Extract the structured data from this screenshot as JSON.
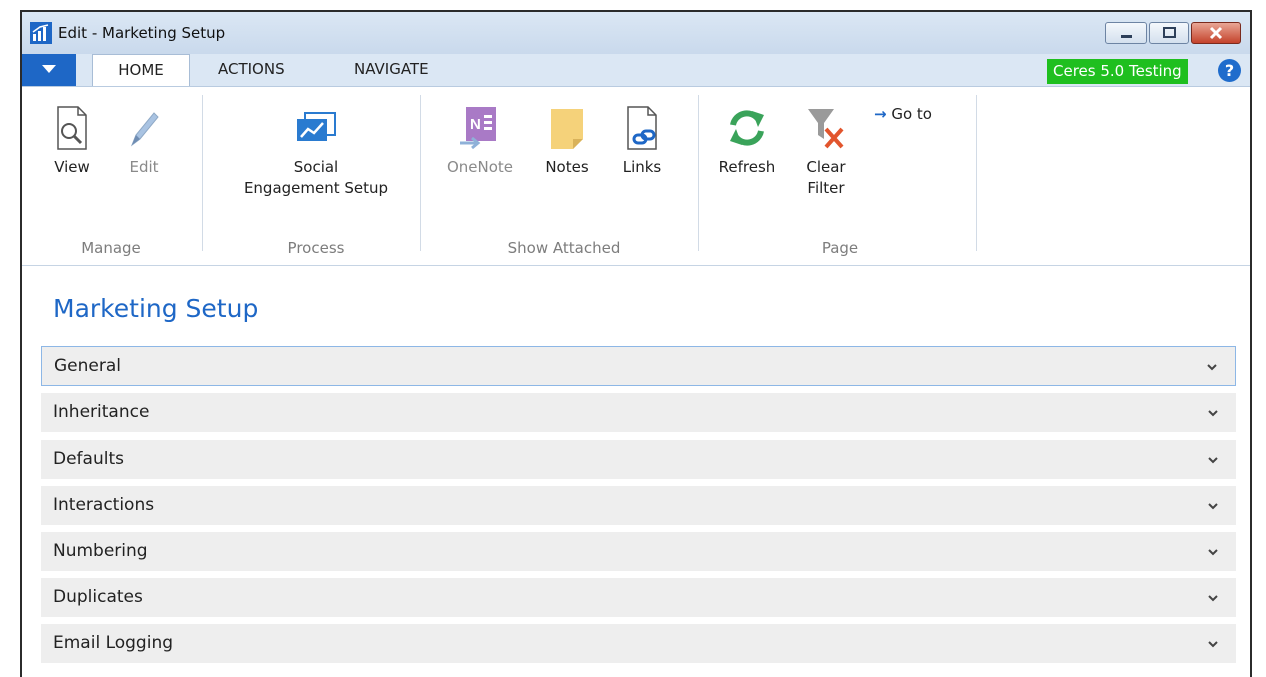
{
  "window": {
    "title": "Edit - Marketing Setup"
  },
  "tabs": {
    "home": "HOME",
    "actions": "ACTIONS",
    "navigate": "NAVIGATE"
  },
  "badge": "Ceres 5.0 Testing",
  "help_label": "?",
  "ribbon": {
    "manage": {
      "view": "View",
      "edit": "Edit",
      "group": "Manage"
    },
    "process": {
      "social_line1": "Social",
      "social_line2": "Engagement Setup",
      "group": "Process"
    },
    "attached": {
      "onenote": "OneNote",
      "notes": "Notes",
      "links": "Links",
      "group": "Show Attached"
    },
    "page": {
      "refresh": "Refresh",
      "clear_line1": "Clear",
      "clear_line2": "Filter",
      "goto": "Go to",
      "group": "Page"
    }
  },
  "page_title": "Marketing Setup",
  "sections": [
    "General",
    "Inheritance",
    "Defaults",
    "Interactions",
    "Numbering",
    "Duplicates",
    "Email Logging"
  ],
  "colors": {
    "accent": "#1e67c6",
    "badge": "#1fbf1f",
    "fasttab": "#eeeeee"
  }
}
